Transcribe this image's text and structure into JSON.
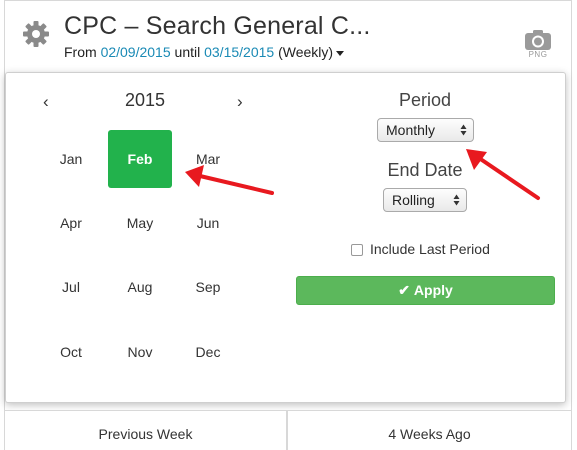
{
  "header": {
    "title": "CPC – Search General C...",
    "subtitle_prefix": "From ",
    "date_from": "02/09/2015",
    "subtitle_mid": " until ",
    "date_to": "03/15/2015",
    "subtitle_granularity": " (Weekly)",
    "export_label": "PNG",
    "settings_icon": "gear-icon",
    "export_icon": "camera-icon"
  },
  "calendar": {
    "year": "2015",
    "prev_symbol": "‹",
    "next_symbol": "›",
    "months": [
      "Jan",
      "Feb",
      "Mar",
      "Apr",
      "May",
      "Jun",
      "Jul",
      "Aug",
      "Sep",
      "Oct",
      "Nov",
      "Dec"
    ],
    "selected_month": "Feb"
  },
  "options": {
    "period_label": "Period",
    "period_value": "Monthly",
    "end_date_label": "End Date",
    "end_date_value": "Rolling",
    "include_last_period_label": "Include Last Period",
    "include_last_period_checked": false,
    "apply_label": "Apply",
    "accent_color": "#5cb85c",
    "selected_month_color": "#22b24c",
    "annotation_arrow_color": "#e8191f"
  },
  "tabs": [
    "Previous Week",
    "4 Weeks Ago"
  ]
}
